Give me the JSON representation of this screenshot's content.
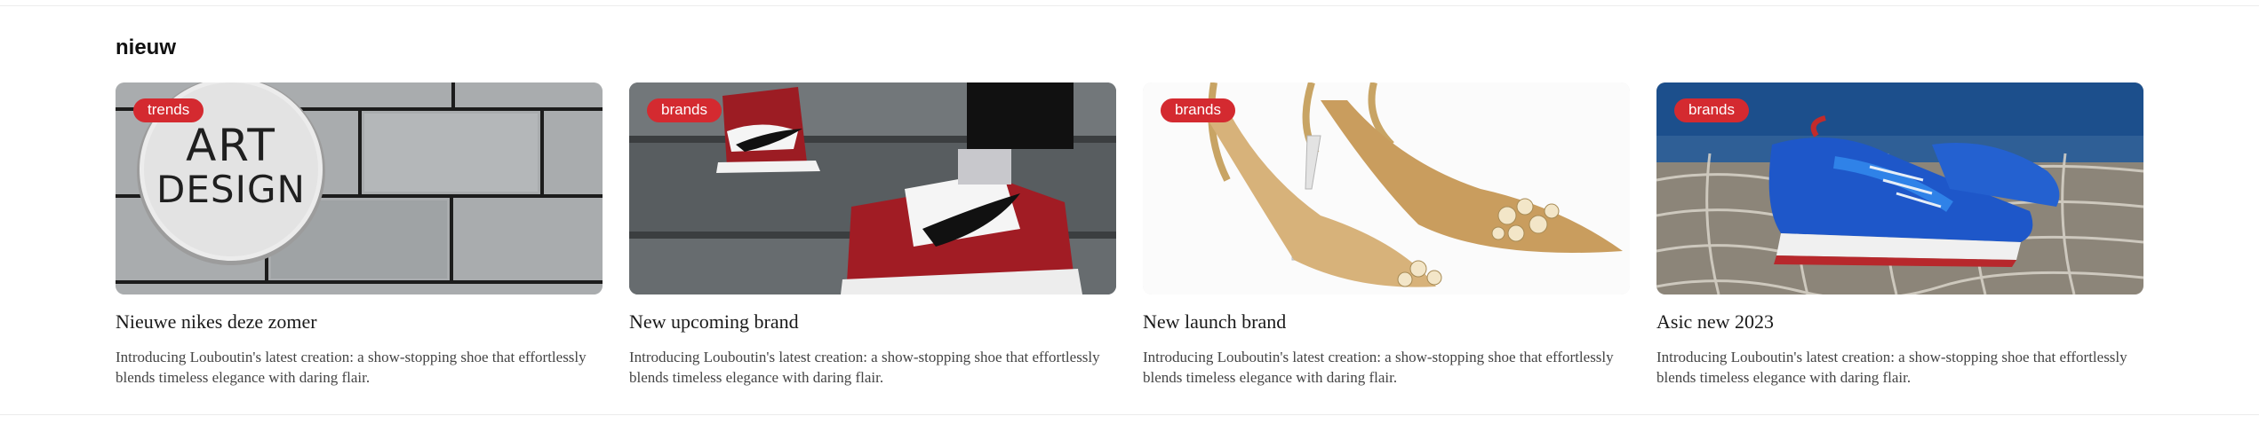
{
  "section": {
    "title": "nieuw"
  },
  "cards": [
    {
      "badge": "trends",
      "image_icon": "art-design-sign-image",
      "sign_line1": "ART",
      "sign_line2": "DESIGN",
      "title": "Nieuwe nikes deze zomer",
      "description": "Introducing Louboutin's latest creation: a show-stopping shoe that effortlessly blends timeless elegance with daring flair."
    },
    {
      "badge": "brands",
      "image_icon": "red-sneakers-on-stairs-image",
      "title": "New upcoming brand",
      "description": "Introducing Louboutin's latest creation: a show-stopping shoe that effortlessly blends timeless elegance with daring flair."
    },
    {
      "badge": "brands",
      "image_icon": "gold-heels-image",
      "title": "New launch brand",
      "description": "Introducing Louboutin's latest creation: a show-stopping shoe that effortlessly blends timeless elegance with daring flair."
    },
    {
      "badge": "brands",
      "image_icon": "blue-sneakers-on-net-image",
      "title": "Asic new 2023",
      "description": "Introducing Louboutin's latest creation: a show-stopping shoe that effortlessly blends timeless elegance with daring flair."
    }
  ],
  "colors": {
    "badge": "#d42a30",
    "text": "#1a1a1a",
    "muted": "#444444"
  }
}
